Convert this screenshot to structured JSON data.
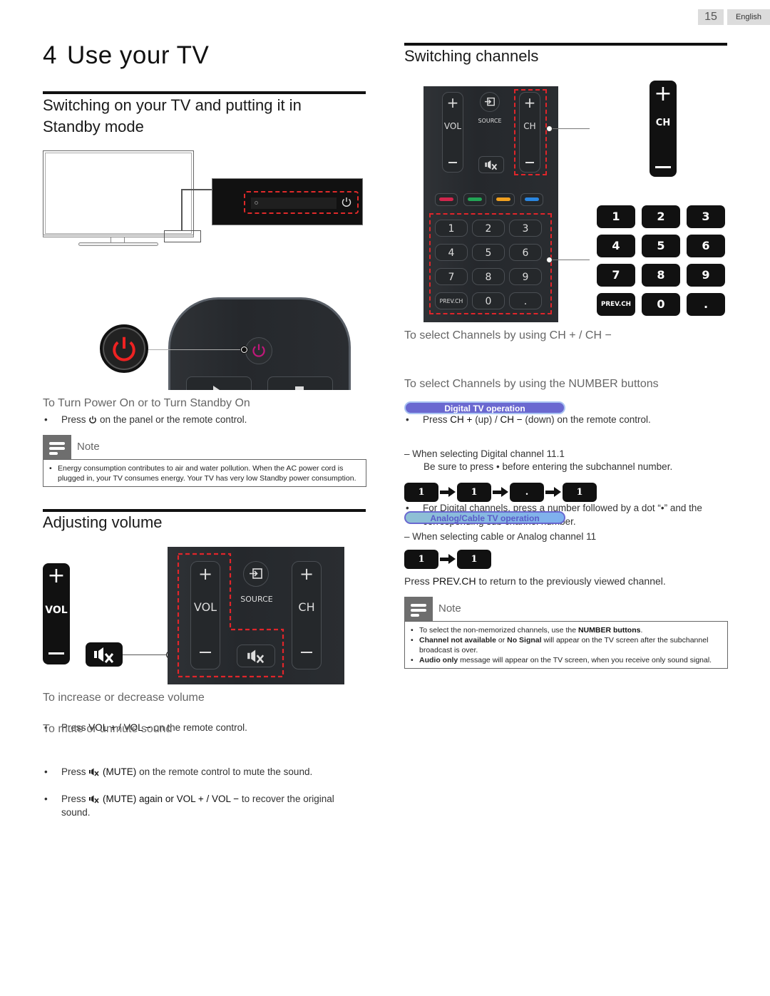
{
  "page": {
    "number": "15",
    "language": "English"
  },
  "chapter": {
    "number": "4",
    "title": "Use your TV"
  },
  "standby": {
    "heading": "Switching on your TV and putting it in Standby mode",
    "subheading": "To Turn Power On or to Turn Standby On",
    "bullet_pre": "Press",
    "bullet_post": "on the panel or the remote control.",
    "note_label": "Note",
    "note_items": [
      "Energy consumption contributes to air and water pollution. When the AC power cord is plugged in, your TV consumes energy. Your TV has very low Standby power consumption."
    ]
  },
  "volume": {
    "heading": "Adjusting volume",
    "vol_label": "VOL",
    "source_label": "SOURCE",
    "ch_label": "CH",
    "sub1": "To increase or decrease volume",
    "sub1_bullet_pre": "Press",
    "sub1_bullet_key": "VOL + / VOL −",
    "sub1_bullet_post": "on the remote control.",
    "sub2": "To mute or unmute sound",
    "sub2_bullets": [
      {
        "pre": "Press",
        "key": "(MUTE)",
        "post": "on the remote control to mute the sound."
      },
      {
        "pre": "Press",
        "key": "(MUTE) again or",
        "key2": "VOL + / VOL −",
        "post": "to recover the original sound."
      }
    ]
  },
  "channels": {
    "heading": "Switching channels",
    "remote": {
      "source_label": "SOURCE",
      "vol_label": "VOL",
      "ch_label": "CH",
      "color_keys": [
        "#d0264c",
        "#22a455",
        "#f0a020",
        "#2a86e0"
      ],
      "number_keys": [
        "1",
        "2",
        "3",
        "4",
        "5",
        "6",
        "7",
        "8",
        "9",
        "PREV.CH",
        "0",
        "."
      ]
    },
    "ch_section": {
      "subheading": "To select Channels by using CH + / CH −",
      "bullet_pre": "Press",
      "bullet_k1": "CH +",
      "bullet_mid": "(up) /",
      "bullet_k2": "CH −",
      "bullet_post": "(down) on the remote control."
    },
    "number_section": {
      "subheading": "To select Channels by using the NUMBER buttons",
      "digital_pill": "Digital TV operation",
      "digital_bullet": "For Digital channels, press a number followed by a dot “•” and the corresponding sub channel number.",
      "digital_example": "– When selecting Digital channel 11.1",
      "digital_hint": "Be sure to press • before entering the subchannel number.",
      "digital_sequence": [
        "1",
        "1",
        ".",
        "1"
      ],
      "analog_pill": "Analog/Cable TV operation",
      "analog_example": "– When selecting cable or Analog channel 11",
      "analog_sequence": [
        "1",
        "1"
      ],
      "prev_pre": "Press",
      "prev_key": "PREV.CH",
      "prev_post": "to return to the previously viewed channel."
    },
    "note_label": "Note",
    "note_items": [
      {
        "pre": "To select the non-memorized channels, use the ",
        "bold": "NUMBER buttons",
        "post": "."
      },
      {
        "bold": "Channel not available",
        "mid": " or ",
        "bold2": "No Signal",
        "post": " will appear on the TV screen after the subchannel broadcast is over."
      },
      {
        "bold": "Audio only",
        "post": " message will appear on the TV screen, when you receive only sound signal."
      }
    ]
  },
  "icons": {
    "power": "power-icon",
    "mute": "mute-icon",
    "source": "source-input-icon",
    "note": "note-icon"
  }
}
